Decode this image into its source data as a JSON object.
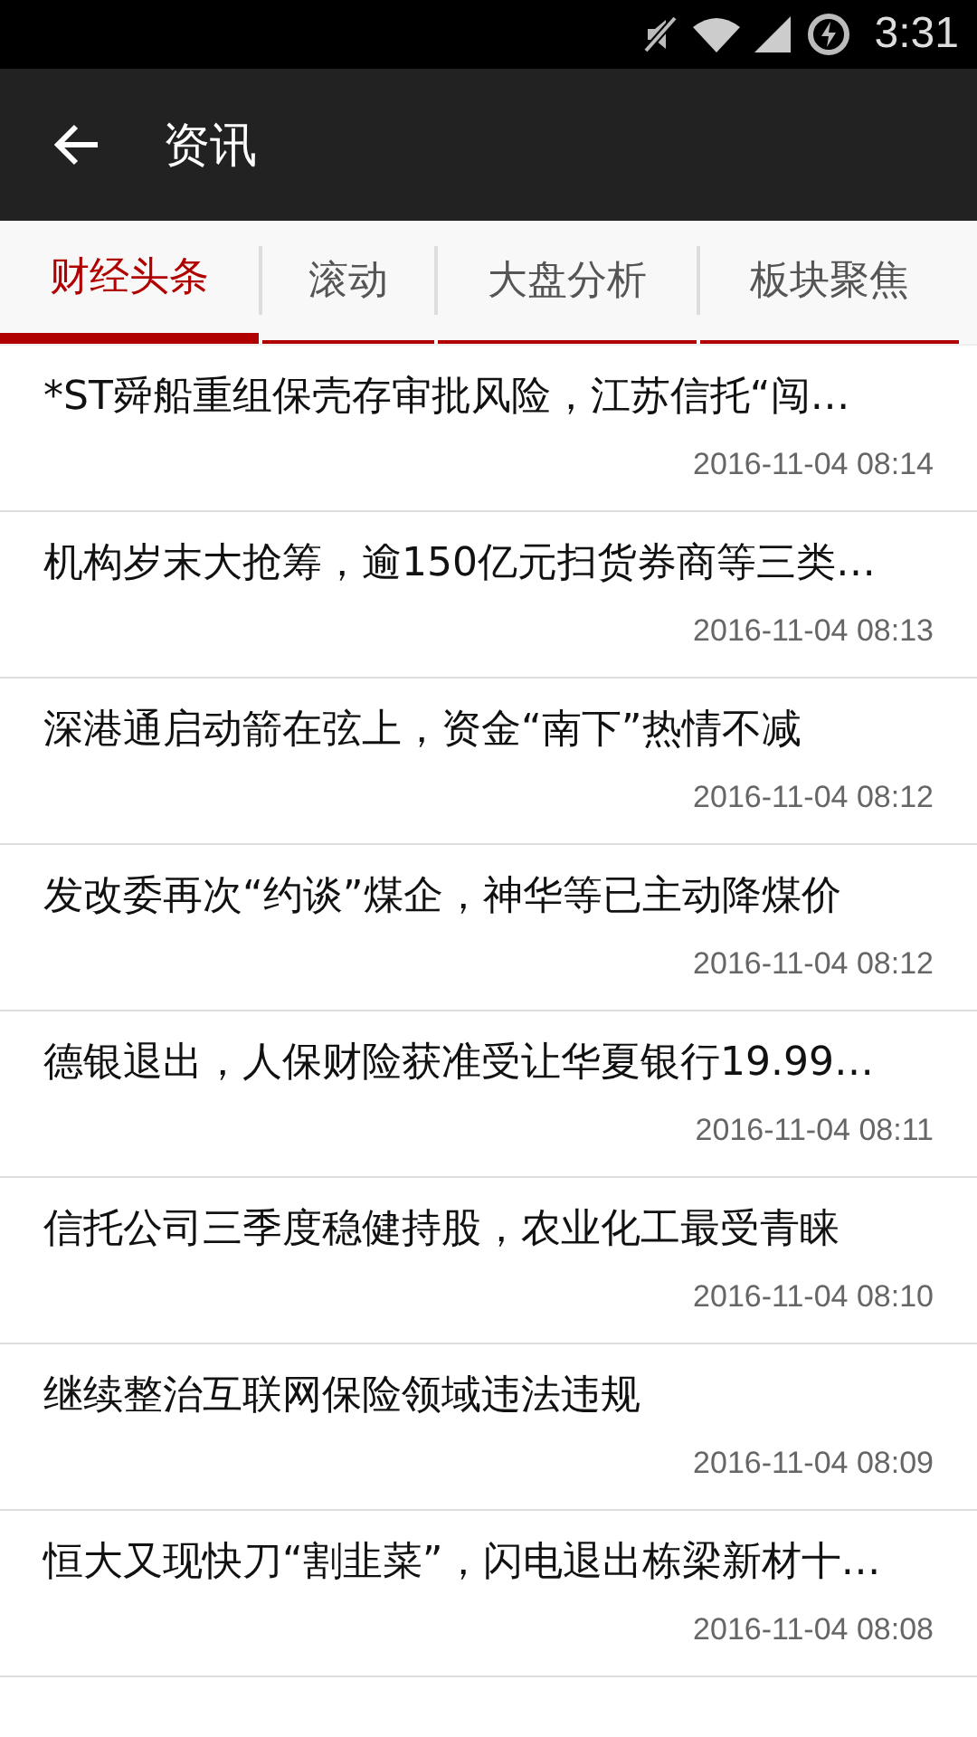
{
  "status_bar": {
    "time": "3:31"
  },
  "app_bar": {
    "title": "资讯"
  },
  "tabs": [
    {
      "label": "财经头条",
      "selected": true
    },
    {
      "label": "滚动",
      "selected": false
    },
    {
      "label": "大盘分析",
      "selected": false
    },
    {
      "label": "板块聚焦",
      "selected": false
    }
  ],
  "news": [
    {
      "title": "*ST舜船重组保壳存审批风险，江苏信托“闯…",
      "time": "2016-11-04 08:14"
    },
    {
      "title": "机构岁末大抢筹，逾150亿元扫货券商等三类…",
      "time": "2016-11-04 08:13"
    },
    {
      "title": "深港通启动箭在弦上，资金“南下”热情不减",
      "time": "2016-11-04 08:12"
    },
    {
      "title": "发改委再次“约谈”煤企，神华等已主动降煤价",
      "time": "2016-11-04 08:12"
    },
    {
      "title": "德银退出，人保财险获准受让华夏银行19.99…",
      "time": "2016-11-04 08:11"
    },
    {
      "title": "信托公司三季度稳健持股，农业化工最受青睐",
      "time": "2016-11-04 08:10"
    },
    {
      "title": "继续整治互联网保险领域违法违规",
      "time": "2016-11-04 08:09"
    },
    {
      "title": "恒大又现快刀“割韭菜”，闪电退出栋梁新材十…",
      "time": "2016-11-04 08:08"
    }
  ]
}
